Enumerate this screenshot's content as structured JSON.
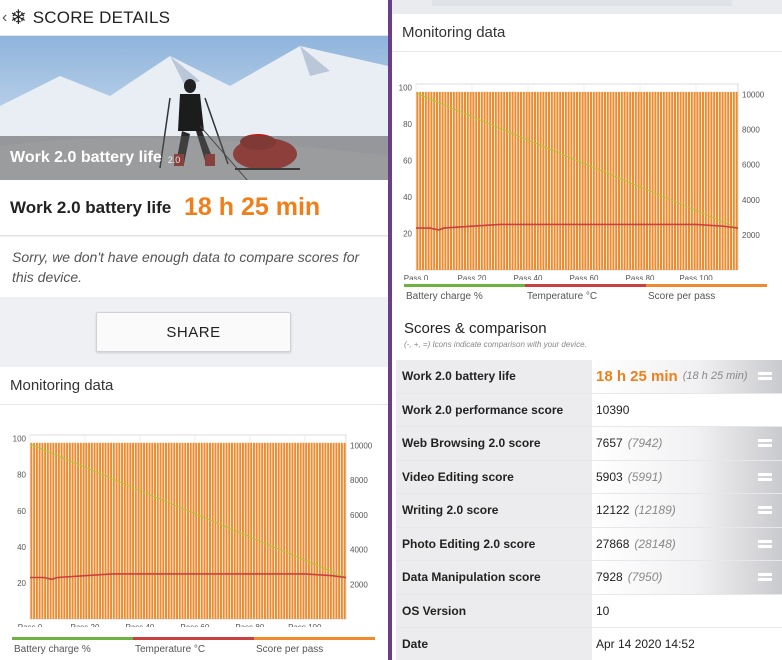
{
  "header": {
    "title": "SCORE DETAILS",
    "icon": "snowflake-icon"
  },
  "hero": {
    "title": "Work 2.0 battery life",
    "version": "2.0"
  },
  "score": {
    "label": "Work 2.0 battery life",
    "value": "18 h 25 min"
  },
  "note": "Sorry, we don't have enough data to compare scores for this device.",
  "share_label": "SHARE",
  "monitoring": {
    "title": "Monitoring data",
    "legend": [
      {
        "label": "Battery charge %",
        "color": "#6cb33f"
      },
      {
        "label": "Temperature °C",
        "color": "#c9403f"
      },
      {
        "label": "Score per pass",
        "color": "#ef8a2f"
      }
    ]
  },
  "chart_data": [
    {
      "type": "bar",
      "title": "Monitoring data",
      "x_tick_labels": [
        "Pass 0",
        "Pass 20",
        "Pass 40",
        "Pass 60",
        "Pass 80",
        "Pass 100"
      ],
      "x_ticks": [
        0,
        20,
        40,
        60,
        80,
        100
      ],
      "xlim": [
        0,
        115
      ],
      "left_axis": {
        "ticks": [
          20,
          40,
          60,
          80,
          100
        ],
        "ylim": [
          0,
          102
        ]
      },
      "right_axis": {
        "ticks": [
          2000,
          4000,
          6000,
          8000,
          10000
        ],
        "ylim": [
          0,
          10600
        ]
      },
      "series": [
        {
          "name": "Battery charge %",
          "type": "line",
          "axis": "left",
          "color": "#a7c93a",
          "x": [
            0,
            115
          ],
          "values": [
            97,
            23
          ]
        },
        {
          "name": "Temperature °C",
          "type": "line",
          "axis": "left",
          "color": "#c9403f",
          "x": [
            0,
            5,
            8,
            10,
            20,
            30,
            40,
            60,
            80,
            100,
            110,
            115
          ],
          "values": [
            23,
            23,
            22,
            23,
            24,
            25,
            25,
            25,
            25,
            25,
            24,
            23
          ]
        },
        {
          "name": "Score per pass",
          "type": "bar",
          "axis": "right",
          "color": "#ef8a2f",
          "approx_value": 10150,
          "count": 115
        }
      ],
      "grid": true,
      "legend": "bottom"
    }
  ],
  "scores": {
    "title": "Scores & comparison",
    "subtitle": "(-, +, =) Icons indicate comparison with your device.",
    "rows": [
      {
        "label": "Work 2.0 battery life",
        "value": "18 h 25 min",
        "compare": "(18 h 25 min)",
        "icon": "equal-icon"
      },
      {
        "label": "Work 2.0 performance score",
        "value": "10390",
        "compare": "",
        "icon": ""
      },
      {
        "label": "Web Browsing 2.0 score",
        "value": "7657",
        "compare": "(7942)",
        "icon": "equal-icon"
      },
      {
        "label": "Video Editing score",
        "value": "5903",
        "compare": "(5991)",
        "icon": "equal-icon"
      },
      {
        "label": "Writing 2.0 score",
        "value": "12122",
        "compare": "(12189)",
        "icon": "equal-icon"
      },
      {
        "label": "Photo Editing 2.0 score",
        "value": "27868",
        "compare": "(28148)",
        "icon": "equal-icon"
      },
      {
        "label": "Data Manipulation score",
        "value": "7928",
        "compare": "(7950)",
        "icon": "equal-icon"
      },
      {
        "label": "OS Version",
        "value": "10",
        "compare": "",
        "icon": ""
      },
      {
        "label": "Date",
        "value": "Apr 14 2020 14:52",
        "compare": "",
        "icon": ""
      }
    ]
  }
}
